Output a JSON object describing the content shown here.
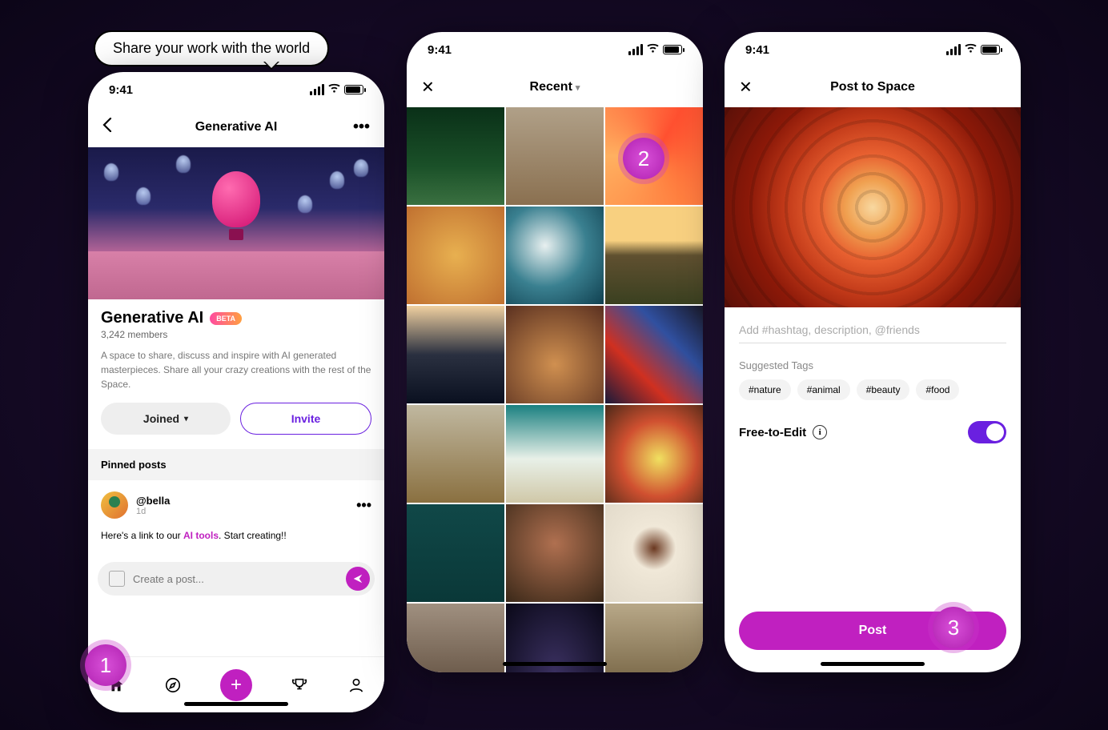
{
  "tooltip": "Share your work with the world",
  "status_time": "9:41",
  "phone1": {
    "title": "Generative AI",
    "space_name": "Generative AI",
    "beta": "BETA",
    "members": "3,242 members",
    "description": "A space to share, discuss and inspire with AI generated masterpieces. Share all your crazy creations with the rest of the Space.",
    "joined": "Joined",
    "invite": "Invite",
    "pinned": "Pinned posts",
    "post_user": "@bella",
    "post_time": "1d",
    "post_text_pre": "Here's a link to our ",
    "post_link": "AI tools",
    "post_text_post": ". Start creating!!",
    "composer_placeholder": "Create a post..."
  },
  "phone2": {
    "title": "Recent"
  },
  "phone3": {
    "title": "Post to Space",
    "caption_placeholder": "Add #hashtag, description, @friends",
    "tags_label": "Suggested Tags",
    "tags": [
      "#nature",
      "#animal",
      "#beauty",
      "#food"
    ],
    "fte": "Free-to-Edit",
    "post_btn": "Post"
  },
  "steps": {
    "s1": "1",
    "s2": "2",
    "s3": "3"
  }
}
